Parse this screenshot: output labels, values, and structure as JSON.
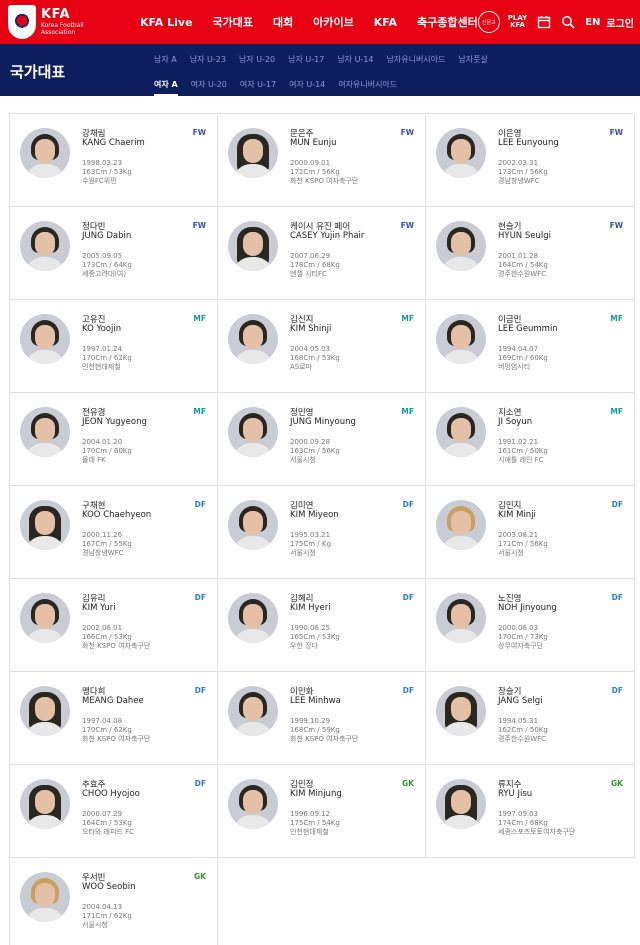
{
  "header": {
    "logo_kfa": "KFA",
    "logo_sub1": "Korea Football",
    "logo_sub2": "Association",
    "nav": [
      "KFA Live",
      "국가대표",
      "대회",
      "아카이브",
      "KFA",
      "축구종합센터"
    ],
    "circle_btn": "신문고",
    "play_kfa_1": "PLAY",
    "play_kfa_2": "KFA",
    "lang": "EN",
    "login": "로그인"
  },
  "subheader": {
    "title": "국가대표",
    "tabs_row1": [
      "남자 A",
      "남자 U-23",
      "남자 U-20",
      "남자 U-17",
      "남자 U-14",
      "남자유니버시아드",
      "남자풋살"
    ],
    "tabs_row2": [
      "여자 A",
      "여자 U-20",
      "여자 U-17",
      "여자 U-14",
      "여자유니버시아드"
    ],
    "active_tab": "여자 A"
  },
  "position_colors": {
    "FW": "#3a4fa8",
    "MF": "#1a9a8a",
    "DF": "#2f7fd0",
    "GK": "#2e9a2e"
  },
  "players": [
    {
      "kname": "강채림",
      "ename": "KANG Chaerim",
      "pos": "FW",
      "birth": "1998.03.23",
      "body": "163Cm / 53Kg",
      "club": "수원FC위민"
    },
    {
      "kname": "문은주",
      "ename": "MUN Eunju",
      "pos": "FW",
      "birth": "2000.09.01",
      "body": "172Cm / 56Kg",
      "club": "화천 KSPO 여자축구단"
    },
    {
      "kname": "이은영",
      "ename": "LEE Eunyoung",
      "pos": "FW",
      "birth": "2002.03.31",
      "body": "173Cm / 56Kg",
      "club": "경남창녕WFC"
    },
    {
      "kname": "정다빈",
      "ename": "JUNG Dabin",
      "pos": "FW",
      "birth": "2005.09.05",
      "body": "173Cm / 64Kg",
      "club": "세종고려대(여)"
    },
    {
      "kname": "케이시 유진 페어",
      "ename": "CASEY Yujin Phair",
      "pos": "FW",
      "birth": "2007.06.29",
      "body": "178Cm / 68Kg",
      "club": "엔젤 시티FC"
    },
    {
      "kname": "현슬기",
      "ename": "HYUN Seulgi",
      "pos": "FW",
      "birth": "2001.01.28",
      "body": "164Cm / 54Kg",
      "club": "경주한수원WFC"
    },
    {
      "kname": "고유진",
      "ename": "KO Yoojin",
      "pos": "MF",
      "birth": "1997.01.24",
      "body": "170Cm / 62Kg",
      "club": "인천현대제철"
    },
    {
      "kname": "김신지",
      "ename": "KIM Shinji",
      "pos": "MF",
      "birth": "2004.05.03",
      "body": "168Cm / 53Kg",
      "club": "AS로마"
    },
    {
      "kname": "이금민",
      "ename": "LEE Geummin",
      "pos": "MF",
      "birth": "1994.04.07",
      "body": "169Cm / 60Kg",
      "club": "버밍엄시티"
    },
    {
      "kname": "전유경",
      "ename": "JEON Yugyeong",
      "pos": "MF",
      "birth": "2004.01.20",
      "body": "170Cm / 60Kg",
      "club": "몰데 FK"
    },
    {
      "kname": "정민영",
      "ename": "JUNG Minyoung",
      "pos": "MF",
      "birth": "2000.09.28",
      "body": "163Cm / 56Kg",
      "club": "서울시청"
    },
    {
      "kname": "지소연",
      "ename": "JI Soyun",
      "pos": "MF",
      "birth": "1991.02.21",
      "body": "161Cm / 50Kg",
      "club": "시애틀 레인 FC"
    },
    {
      "kname": "구채현",
      "ename": "KOO Chaehyeon",
      "pos": "DF",
      "birth": "2000.11.26",
      "body": "167Cm / 55Kg",
      "club": "경남창녕WFC"
    },
    {
      "kname": "김미연",
      "ename": "KIM Miyeon",
      "pos": "DF",
      "birth": "1995.03.21",
      "body": "175Cm / Kg",
      "club": "서울시청"
    },
    {
      "kname": "김민지",
      "ename": "KIM Minji",
      "pos": "DF",
      "birth": "2003.08.21",
      "body": "171Cm / 56Kg",
      "club": "서울시청"
    },
    {
      "kname": "김유리",
      "ename": "KIM Yuri",
      "pos": "DF",
      "birth": "2002.06.01",
      "body": "166Cm / 53Kg",
      "club": "화천 KSPO 여자축구단"
    },
    {
      "kname": "김혜리",
      "ename": "KIM Hyeri",
      "pos": "DF",
      "birth": "1990.06.25",
      "body": "165Cm / 53Kg",
      "club": "우한 장다"
    },
    {
      "kname": "노진영",
      "ename": "NOH Jinyoung",
      "pos": "DF",
      "birth": "2000.06.03",
      "body": "170Cm / 73Kg",
      "club": "상무여자축구단"
    },
    {
      "kname": "맹다희",
      "ename": "MEANG Dahee",
      "pos": "DF",
      "birth": "1997.04.08",
      "body": "170Cm / 62Kg",
      "club": "화천 KSPO 여자축구단"
    },
    {
      "kname": "이민화",
      "ename": "LEE Minhwa",
      "pos": "DF",
      "birth": "1999.10.29",
      "body": "168Cm / 59Kg",
      "club": "화천 KSPO 여자축구단"
    },
    {
      "kname": "장슬기",
      "ename": "JANG Selgi",
      "pos": "DF",
      "birth": "1994.05.31",
      "body": "162Cm / 50Kg",
      "club": "경주한수원WFC"
    },
    {
      "kname": "추효주",
      "ename": "CHOO Hyojoo",
      "pos": "DF",
      "birth": "2000.07.29",
      "body": "164Cm / 53Kg",
      "club": "오타와 래피드 FC"
    },
    {
      "kname": "김민정",
      "ename": "KIM Minjung",
      "pos": "GK",
      "birth": "1996.09.12",
      "body": "175Cm / 54Kg",
      "club": "인천현대제철"
    },
    {
      "kname": "류지수",
      "ename": "RYU Jisu",
      "pos": "GK",
      "birth": "1997.09.03",
      "body": "174Cm / 68Kg",
      "club": "세종스포츠토토여자축구단"
    },
    {
      "kname": "우서빈",
      "ename": "WOO Seobin",
      "pos": "GK",
      "birth": "2004.04.13",
      "body": "171Cm / 62Kg",
      "club": "서울시청"
    }
  ]
}
